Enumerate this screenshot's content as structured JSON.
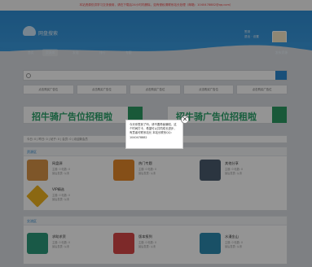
{
  "notice": "本站资源仅供学习交流使用，请在下载后24小时内删除，如有侵权请联系站长处理（邮箱：1040478882@qq.com）",
  "header": {
    "logo_text": "网盘搜索",
    "user_line1": "签到",
    "user_line2": "退出 · 设置"
  },
  "nav": {
    "items": [
      "首页",
      "资源库",
      "发现",
      "排行",
      "专题"
    ],
    "right": "发布资源"
  },
  "search": {
    "placeholder": "搜索资源、文件、用户"
  },
  "ads": [
    "点击购买广告位",
    "点击购买广告位",
    "点击购买广告位",
    "点击购买广告位",
    "点击购买广告位"
  ],
  "banners": [
    "招牛骑广告位招租啦",
    "招牛骑广告位招租啦"
  ],
  "infobar": {
    "text": "今日: 0 | 昨日: 0 | 帖子: 0 | 会员: 0 | 欢迎新会员",
    "right": "最新 admin"
  },
  "section1": {
    "title": "资源区",
    "tiles": [
      {
        "name": "网盘源",
        "meta": "主题: 0 帖数: 0\n最后发表: 从未",
        "color": "#d99548"
      },
      {
        "name": "热门专题",
        "meta": "主题: 0 帖数: 0\n最后发表: 从未",
        "color": "#e5882a"
      },
      {
        "name": "其他分享",
        "meta": "主题: 0 帖数: 0\n最后发表: 从未",
        "color": "#4a5c6e"
      },
      {
        "name": "VIP精选",
        "meta": "主题: 0 帖数: 0\n最后发表: 从未",
        "color": "#f0b420"
      }
    ]
  },
  "section2": {
    "title": "交流区",
    "tiles": [
      {
        "name": "求助求资",
        "meta": "主题: 0 帖数: 0\n最后发表: 从未",
        "color": "#2c9a7a"
      },
      {
        "name": "版本报到",
        "meta": "主题: 0 帖数: 0\n最后发表: 从未",
        "color": "#d84848"
      },
      {
        "name": "水漫金山",
        "meta": "主题: 0 帖数: 0\n最后发表: 从未",
        "color": "#2c8ab0"
      }
    ]
  },
  "popup": {
    "text": "今天你签到了吗，请不要再偷懒啦，这个时间打卡，希望可以共同成长进步，有意者可联系站长 本站长联系QQ：1040478882",
    "close": "✕"
  }
}
